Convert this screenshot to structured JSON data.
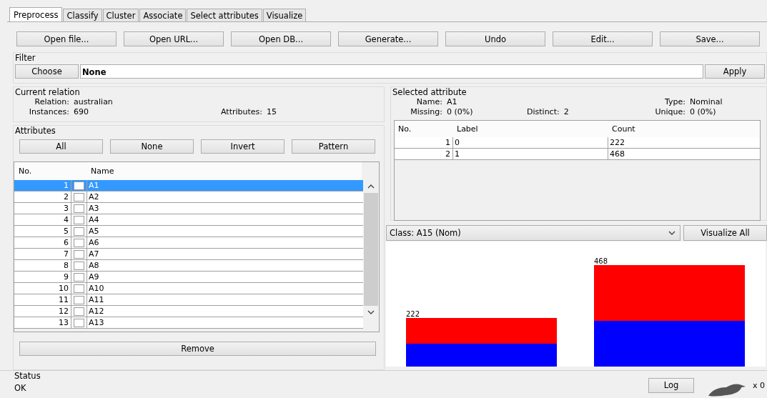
{
  "tabs": [
    {
      "label": "Preprocess",
      "selected": true
    },
    {
      "label": "Classify",
      "selected": false
    },
    {
      "label": "Cluster",
      "selected": false
    },
    {
      "label": "Associate",
      "selected": false
    },
    {
      "label": "Select attributes",
      "selected": false
    },
    {
      "label": "Visualize",
      "selected": false
    }
  ],
  "toolbar_buttons": [
    "Open file...",
    "Open URL...",
    "Open DB...",
    "Generate...",
    "Undo",
    "Edit...",
    "Save..."
  ],
  "filter": {
    "title": "Filter",
    "choose_button": "Choose",
    "value": "None",
    "apply_button": "Apply"
  },
  "current_relation": {
    "title": "Current relation",
    "fields": [
      {
        "label": "Relation:",
        "value": "australian"
      },
      {
        "label": "Instances:",
        "value": "690"
      },
      {
        "label": "Attributes:",
        "value": "15"
      }
    ]
  },
  "attributes": {
    "title": "Attributes",
    "buttons": [
      "All",
      "None",
      "Invert",
      "Pattern"
    ],
    "columns": [
      "No.",
      "Name"
    ],
    "rows": [
      {
        "no": "1",
        "name": "A1",
        "checked": false,
        "selected": true
      },
      {
        "no": "2",
        "name": "A2",
        "checked": false,
        "selected": false
      },
      {
        "no": "3",
        "name": "A3",
        "checked": false,
        "selected": false
      },
      {
        "no": "4",
        "name": "A4",
        "checked": false,
        "selected": false
      },
      {
        "no": "5",
        "name": "A5",
        "checked": false,
        "selected": false
      },
      {
        "no": "6",
        "name": "A6",
        "checked": false,
        "selected": false
      },
      {
        "no": "7",
        "name": "A7",
        "checked": false,
        "selected": false
      },
      {
        "no": "8",
        "name": "A8",
        "checked": false,
        "selected": false
      },
      {
        "no": "9",
        "name": "A9",
        "checked": false,
        "selected": false
      },
      {
        "no": "10",
        "name": "A10",
        "checked": false,
        "selected": false
      },
      {
        "no": "11",
        "name": "A11",
        "checked": false,
        "selected": false
      },
      {
        "no": "12",
        "name": "A12",
        "checked": false,
        "selected": false
      },
      {
        "no": "13",
        "name": "A13",
        "checked": false,
        "selected": false
      }
    ],
    "remove_button": "Remove"
  },
  "selected_attribute": {
    "title": "Selected attribute",
    "fields": [
      {
        "label": "Name:",
        "value": "A1"
      },
      {
        "label": "Type:",
        "value": "Nominal"
      },
      {
        "label": "Missing:",
        "value": "0 (0%)"
      },
      {
        "label": "Distinct:",
        "value": "2"
      },
      {
        "label": "Unique:",
        "value": "0 (0%)"
      }
    ],
    "table": {
      "columns": [
        "No.",
        "Label",
        "Count"
      ],
      "rows": [
        [
          "1",
          "0",
          "222"
        ],
        [
          "2",
          "1",
          "468"
        ]
      ]
    }
  },
  "class_select": {
    "value": "Class: A15 (Nom)"
  },
  "visualize_all_button": "Visualize All",
  "class_histogram": {
    "bars": [
      {
        "value_label": "222",
        "segments": [
          {
            "color": "#0000ff"
          },
          {
            "color": "#ff0000"
          }
        ]
      },
      {
        "value_label": "468",
        "segments": [
          {
            "color": "#0000ff"
          },
          {
            "color": "#ff0000"
          }
        ]
      }
    ]
  },
  "status": {
    "title": "Status",
    "message": "OK",
    "log_button": "Log",
    "task_count": "x 0"
  }
}
